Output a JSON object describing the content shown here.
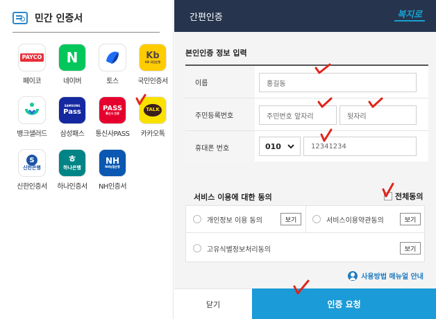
{
  "left": {
    "title": "민간 인증서",
    "providers": [
      {
        "label": "페이코",
        "logo": "PAYCO"
      },
      {
        "label": "네이버",
        "logo": "N"
      },
      {
        "label": "토스",
        "logo": "toss-icon"
      },
      {
        "label": "국민인증서",
        "logo": "Kb",
        "logo_sub": "KB 국민은행"
      },
      {
        "label": "뱅크샐러드",
        "logo": "banksalad-icon"
      },
      {
        "label": "삼성패스",
        "logo": "Pass",
        "logo_sub": "SAMSUNG"
      },
      {
        "label": "통신사PASS",
        "logo": "PASS",
        "logo_sub": "통신사 인증"
      },
      {
        "label": "카카오톡",
        "logo": "TALK"
      },
      {
        "label": "신한인증서",
        "logo": "신한은행",
        "logo_mark": "S"
      },
      {
        "label": "하나인증서",
        "logo": "하나은행",
        "logo_mark": "ㅎ"
      },
      {
        "label": "NH인증서",
        "logo": "NH",
        "logo_sub": "NH농협은행"
      }
    ]
  },
  "right": {
    "header_title": "간편인증",
    "brand": "복지로",
    "section_title": "본인인증 정보 입력",
    "form": {
      "name_label": "이름",
      "name_value": "홍길동",
      "rrn_label": "주민등록번호",
      "rrn_front_placeholder": "주민번호 앞자리",
      "rrn_back_placeholder": "뒷자리",
      "phone_label": "휴대폰 번호",
      "phone_prefix": "010",
      "phone_value": "12341234"
    },
    "agree": {
      "title": "서비스 이용에 대한 동의",
      "all_label": "전체동의",
      "items": [
        {
          "label": "개인정보 이용 동의",
          "view": "보기"
        },
        {
          "label": "서비스이용약관동의",
          "view": "보기"
        },
        {
          "label": "고유식별정보처리동의",
          "view": "보기"
        }
      ]
    },
    "manual_link": "사용방법 매뉴얼 안내",
    "close_label": "닫기",
    "request_label": "인증 요청"
  },
  "colors": {
    "header_bg": "#26344d",
    "accent": "#1b9bd7",
    "annotation": "#e2231a"
  }
}
